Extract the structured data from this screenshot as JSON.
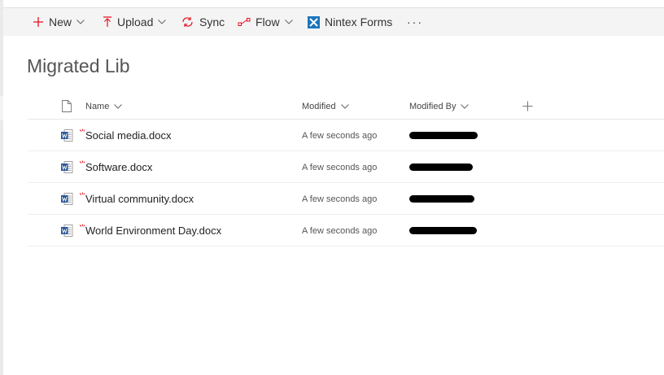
{
  "commandbar": {
    "new_label": "New",
    "upload_label": "Upload",
    "sync_label": "Sync",
    "flow_label": "Flow",
    "nintex_label": "Nintex Forms",
    "more_label": "···"
  },
  "library": {
    "title": "Migrated Lib"
  },
  "columns": {
    "name": "Name",
    "modified": "Modified",
    "modified_by": "Modified By"
  },
  "files": [
    {
      "name": "Social media.docx",
      "modified": "A few seconds ago",
      "modified_by": ""
    },
    {
      "name": "Software.docx",
      "modified": "A few seconds ago",
      "modified_by": ""
    },
    {
      "name": "Virtual community.docx",
      "modified": "A few seconds ago",
      "modified_by": ""
    },
    {
      "name": "World Environment Day.docx",
      "modified": "A few seconds ago",
      "modified_by": ""
    }
  ],
  "colors": {
    "accent_red": "#e81123",
    "nintex_blue": "#1b75bb",
    "word_blue": "#2b579a"
  }
}
